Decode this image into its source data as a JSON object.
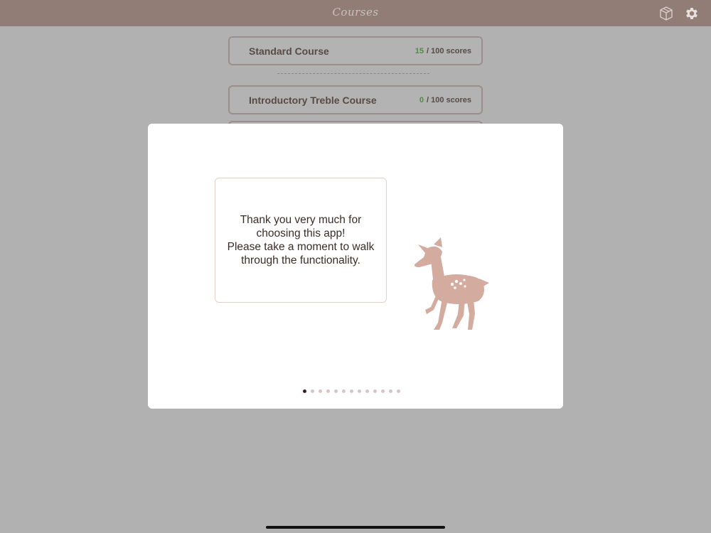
{
  "header": {
    "title": "Courses",
    "icons": [
      "box-icon",
      "gear-icon"
    ]
  },
  "courses": [
    {
      "name": "Standard Course",
      "count": "15",
      "total": "/ 100 scores"
    },
    {
      "name": "Introductory Treble Course",
      "count": "0",
      "total": "/ 100 scores"
    }
  ],
  "modal": {
    "message": "Thank you very much for choosing this app!\nPlease take a moment to walk through the functionality.",
    "pager": {
      "current": 1,
      "total": 13
    }
  },
  "colors": {
    "header_bg": "#917c76",
    "accent_green": "#4e8c40",
    "deer": "#d3ab9f",
    "dot_active": "#3a1e1b",
    "dot_inactive": "#dbc4c1"
  }
}
